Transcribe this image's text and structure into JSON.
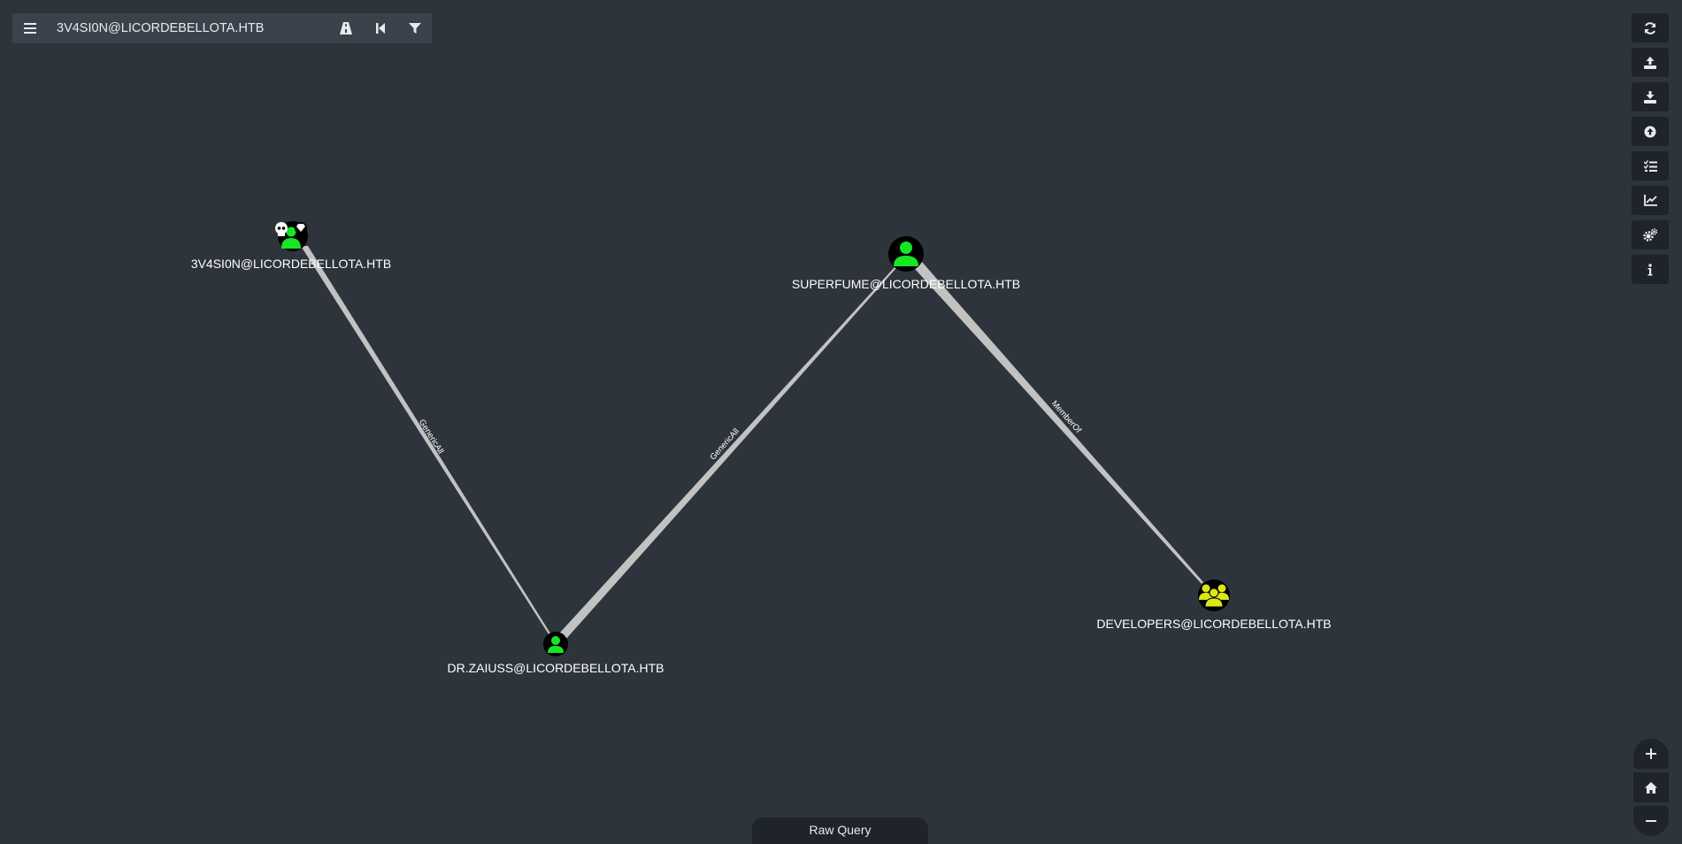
{
  "topbar": {
    "search_value": "3V4SI0N@LICORDEBELLOTA.HTB",
    "menu_icon": "hamburger-menu-icon",
    "pathfinding_icon": "road-icon",
    "back_icon": "step-backward-icon",
    "filter_icon": "filter-icon"
  },
  "graph": {
    "nodes": {
      "evasion": {
        "label": "3V4SI0N@LICORDEBELLOTA.HTB",
        "type": "user",
        "badges": [
          "skull-icon",
          "gem-icon"
        ]
      },
      "superfume": {
        "label": "SUPERFUME@LICORDEBELLOTA.HTB",
        "type": "user"
      },
      "zaiuss": {
        "label": "DR.ZAIUSS@LICORDEBELLOTA.HTB",
        "type": "user"
      },
      "developers": {
        "label": "DEVELOPERS@LICORDEBELLOTA.HTB",
        "type": "group"
      }
    },
    "edges": {
      "e1": {
        "label": "GenericAll",
        "from": "3V4SI0N@LICORDEBELLOTA.HTB",
        "to": "DR.ZAIUSS@LICORDEBELLOTA.HTB"
      },
      "e2": {
        "label": "GenericAll",
        "from": "DR.ZAIUSS@LICORDEBELLOTA.HTB",
        "to": "SUPERFUME@LICORDEBELLOTA.HTB"
      },
      "e3": {
        "label": "MemberOf",
        "from": "SUPERFUME@LICORDEBELLOTA.HTB",
        "to": "DEVELOPERS@LICORDEBELLOTA.HTB"
      }
    },
    "colors": {
      "background": "#2e343c",
      "user_node": "#17e625",
      "group_node": "#dbe617",
      "node_circle": "#000000",
      "edge": "#c2c2c2"
    }
  },
  "rightbar": {
    "buttons": [
      "refresh-icon",
      "upload-icon",
      "download-icon",
      "upload-circle-icon",
      "tasks-icon",
      "chart-line-icon",
      "cogs-icon",
      "info-icon"
    ]
  },
  "zoom": {
    "buttons": [
      "plus-icon",
      "home-icon",
      "minus-icon"
    ]
  },
  "raw_query": {
    "label": "Raw Query"
  }
}
